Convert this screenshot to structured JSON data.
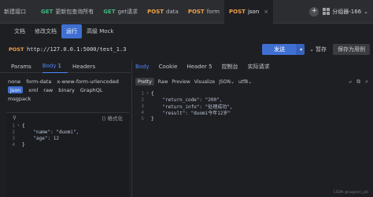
{
  "tabs": [
    {
      "method": "",
      "label": "新建接口",
      "active": false
    },
    {
      "method": "GET",
      "label": "更新包查询所有",
      "active": false
    },
    {
      "method": "GET",
      "label": "get请求",
      "active": false
    },
    {
      "method": "POST",
      "label": "data",
      "active": false
    },
    {
      "method": "POST",
      "label": "form",
      "active": false
    },
    {
      "method": "POST",
      "label": "json",
      "active": true
    }
  ],
  "tab_close_glyph": "×",
  "add_tab_glyph": "+",
  "environment": {
    "label": "分组器-166",
    "chevron": "⌄"
  },
  "subnav": [
    "文档",
    "修改文档",
    "运行",
    "高级 Mock"
  ],
  "subnav_active": "运行",
  "request": {
    "method": "POST",
    "url": "http://127.0.0.1:5000/test_1.3",
    "send_label": "发送",
    "save_label": "暂存",
    "save_as_label": "保存为用例"
  },
  "left_tabs": [
    {
      "label": "Params",
      "badge": ""
    },
    {
      "label": "Body",
      "badge": "1"
    },
    {
      "label": "Headers",
      "badge": ""
    }
  ],
  "left_tab_active": "Body",
  "body_types": [
    "none",
    "form-data",
    "x-www-form-urlencoded",
    "json",
    "xml",
    "raw",
    "binary",
    "GraphQL",
    "msgpack"
  ],
  "body_type_active": "json",
  "left_editor": {
    "format_label": "格式化",
    "lines": [
      {
        "n": "1",
        "text": "{"
      },
      {
        "n": "2",
        "text": "    \"name\": \"duomi\","
      },
      {
        "n": "3",
        "text": "    \"age\": 12"
      },
      {
        "n": "4",
        "text": "}"
      }
    ]
  },
  "right_tabs": [
    "Body",
    "Cookie",
    "Header 5",
    "控制台",
    "实际请求"
  ],
  "right_tab_active": "Body",
  "response_views": [
    "Pretty",
    "Raw",
    "Preview",
    "Visualize",
    "JSON",
    "utf8"
  ],
  "response_view_active": "Pretty",
  "response_lines": [
    {
      "n": "1",
      "text": "{"
    },
    {
      "n": "2",
      "text": "    \"return_code\": \"200\","
    },
    {
      "n": "3",
      "text": "    \"return_info\": \"处理成功\","
    },
    {
      "n": "4",
      "text": "    \"result\": \"duomi今年12岁\""
    },
    {
      "n": "5",
      "text": "}"
    }
  ],
  "watermark": "CSDN @sugeeri_ybl",
  "colors": {
    "accent": "#3f6fd1",
    "get": "#3fb97e",
    "post": "#f0a04b",
    "active_tab_text": "#4a86ff"
  }
}
